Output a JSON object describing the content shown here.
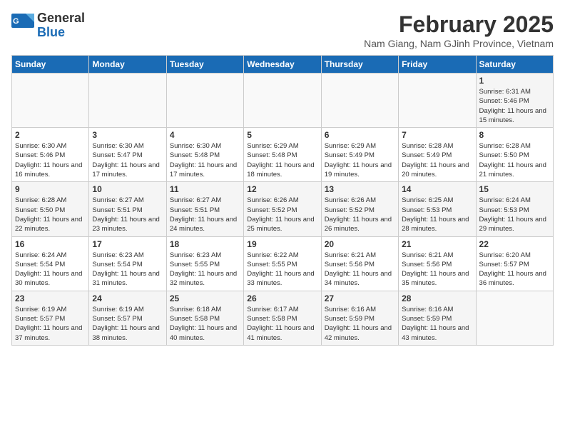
{
  "logo": {
    "general": "General",
    "blue": "Blue"
  },
  "header": {
    "month_year": "February 2025",
    "location": "Nam Giang, Nam GJinh Province, Vietnam"
  },
  "weekdays": [
    "Sunday",
    "Monday",
    "Tuesday",
    "Wednesday",
    "Thursday",
    "Friday",
    "Saturday"
  ],
  "weeks": [
    {
      "days": [
        {
          "num": "",
          "info": ""
        },
        {
          "num": "",
          "info": ""
        },
        {
          "num": "",
          "info": ""
        },
        {
          "num": "",
          "info": ""
        },
        {
          "num": "",
          "info": ""
        },
        {
          "num": "",
          "info": ""
        },
        {
          "num": "1",
          "info": "Sunrise: 6:31 AM\nSunset: 5:46 PM\nDaylight: 11 hours and 15 minutes."
        }
      ]
    },
    {
      "days": [
        {
          "num": "2",
          "info": "Sunrise: 6:30 AM\nSunset: 5:46 PM\nDaylight: 11 hours and 16 minutes."
        },
        {
          "num": "3",
          "info": "Sunrise: 6:30 AM\nSunset: 5:47 PM\nDaylight: 11 hours and 17 minutes."
        },
        {
          "num": "4",
          "info": "Sunrise: 6:30 AM\nSunset: 5:48 PM\nDaylight: 11 hours and 17 minutes."
        },
        {
          "num": "5",
          "info": "Sunrise: 6:29 AM\nSunset: 5:48 PM\nDaylight: 11 hours and 18 minutes."
        },
        {
          "num": "6",
          "info": "Sunrise: 6:29 AM\nSunset: 5:49 PM\nDaylight: 11 hours and 19 minutes."
        },
        {
          "num": "7",
          "info": "Sunrise: 6:28 AM\nSunset: 5:49 PM\nDaylight: 11 hours and 20 minutes."
        },
        {
          "num": "8",
          "info": "Sunrise: 6:28 AM\nSunset: 5:50 PM\nDaylight: 11 hours and 21 minutes."
        }
      ]
    },
    {
      "days": [
        {
          "num": "9",
          "info": "Sunrise: 6:28 AM\nSunset: 5:50 PM\nDaylight: 11 hours and 22 minutes."
        },
        {
          "num": "10",
          "info": "Sunrise: 6:27 AM\nSunset: 5:51 PM\nDaylight: 11 hours and 23 minutes."
        },
        {
          "num": "11",
          "info": "Sunrise: 6:27 AM\nSunset: 5:51 PM\nDaylight: 11 hours and 24 minutes."
        },
        {
          "num": "12",
          "info": "Sunrise: 6:26 AM\nSunset: 5:52 PM\nDaylight: 11 hours and 25 minutes."
        },
        {
          "num": "13",
          "info": "Sunrise: 6:26 AM\nSunset: 5:52 PM\nDaylight: 11 hours and 26 minutes."
        },
        {
          "num": "14",
          "info": "Sunrise: 6:25 AM\nSunset: 5:53 PM\nDaylight: 11 hours and 28 minutes."
        },
        {
          "num": "15",
          "info": "Sunrise: 6:24 AM\nSunset: 5:53 PM\nDaylight: 11 hours and 29 minutes."
        }
      ]
    },
    {
      "days": [
        {
          "num": "16",
          "info": "Sunrise: 6:24 AM\nSunset: 5:54 PM\nDaylight: 11 hours and 30 minutes."
        },
        {
          "num": "17",
          "info": "Sunrise: 6:23 AM\nSunset: 5:54 PM\nDaylight: 11 hours and 31 minutes."
        },
        {
          "num": "18",
          "info": "Sunrise: 6:23 AM\nSunset: 5:55 PM\nDaylight: 11 hours and 32 minutes."
        },
        {
          "num": "19",
          "info": "Sunrise: 6:22 AM\nSunset: 5:55 PM\nDaylight: 11 hours and 33 minutes."
        },
        {
          "num": "20",
          "info": "Sunrise: 6:21 AM\nSunset: 5:56 PM\nDaylight: 11 hours and 34 minutes."
        },
        {
          "num": "21",
          "info": "Sunrise: 6:21 AM\nSunset: 5:56 PM\nDaylight: 11 hours and 35 minutes."
        },
        {
          "num": "22",
          "info": "Sunrise: 6:20 AM\nSunset: 5:57 PM\nDaylight: 11 hours and 36 minutes."
        }
      ]
    },
    {
      "days": [
        {
          "num": "23",
          "info": "Sunrise: 6:19 AM\nSunset: 5:57 PM\nDaylight: 11 hours and 37 minutes."
        },
        {
          "num": "24",
          "info": "Sunrise: 6:19 AM\nSunset: 5:57 PM\nDaylight: 11 hours and 38 minutes."
        },
        {
          "num": "25",
          "info": "Sunrise: 6:18 AM\nSunset: 5:58 PM\nDaylight: 11 hours and 40 minutes."
        },
        {
          "num": "26",
          "info": "Sunrise: 6:17 AM\nSunset: 5:58 PM\nDaylight: 11 hours and 41 minutes."
        },
        {
          "num": "27",
          "info": "Sunrise: 6:16 AM\nSunset: 5:59 PM\nDaylight: 11 hours and 42 minutes."
        },
        {
          "num": "28",
          "info": "Sunrise: 6:16 AM\nSunset: 5:59 PM\nDaylight: 11 hours and 43 minutes."
        },
        {
          "num": "",
          "info": ""
        }
      ]
    }
  ]
}
